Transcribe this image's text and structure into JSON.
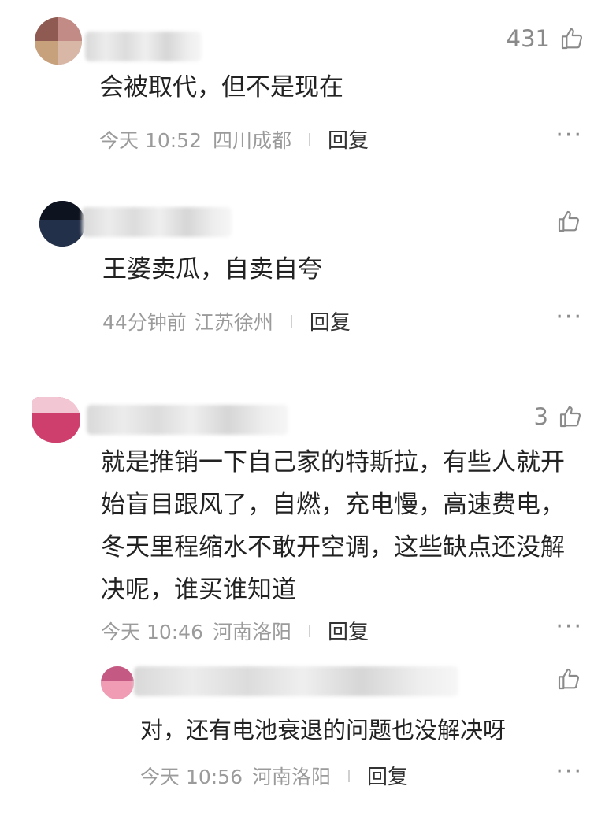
{
  "comments": [
    {
      "likes": "431",
      "text": "会被取代，但不是现在",
      "time": "今天 10:52",
      "location": "四川成都",
      "reply_label": "回复",
      "more_label": "···"
    },
    {
      "likes": "",
      "text": "王婆卖瓜，自卖自夸",
      "time": "44分钟前",
      "location": "江苏徐州",
      "reply_label": "回复",
      "more_label": "···"
    },
    {
      "likes": "3",
      "text": "就是推销一下自己家的特斯拉，有些人就开始盲目跟风了，自燃，充电慢，高速费电，冬天里程缩水不敢开空调，这些缺点还没解决呢，谁买谁知道",
      "time": "今天 10:46",
      "location": "河南洛阳",
      "reply_label": "回复",
      "more_label": "···"
    },
    {
      "likes": "",
      "text": "对，还有电池衰退的问题也没解决呀",
      "time": "今天 10:56",
      "location": "河南洛阳",
      "reply_label": "回复",
      "more_label": "···"
    }
  ],
  "icons": {
    "like": "thumbs-up-icon",
    "more": "more-icon"
  },
  "colors": {
    "text": "#222222",
    "meta": "#9b9b9b",
    "icon": "#8a8a8a"
  }
}
